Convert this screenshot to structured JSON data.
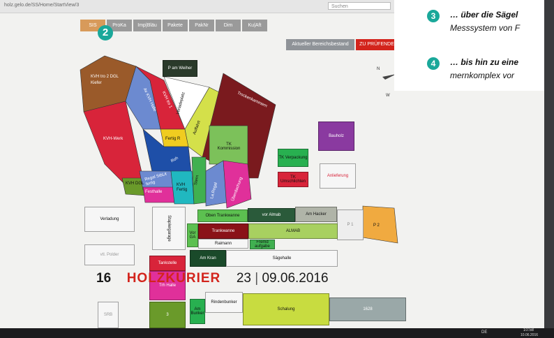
{
  "browser": {
    "url": "holz.gelo.de/SS/Home/StartView/3",
    "search_placeholder": "Suchen"
  },
  "menu": {
    "items": [
      "SIS",
      "ProKa",
      "Imp|Bläu",
      "Pakete",
      "PakNr",
      "Dim",
      "Ku|Aft"
    ],
    "active_index": 0
  },
  "badge_step": "2",
  "header_buttons": {
    "inventory": "Aktueller Bereichsbestand",
    "check": "ZU PRÜFENDE"
  },
  "zones": {
    "kvh_tro": "KVH tro 2 DGL Kiefer",
    "kvh_werk": "KVH-Werk",
    "av_kvh_halle": "Av KVH Halle",
    "kvh_tro1": "KVH tro 1",
    "p_am_weiher": "P am Weiher",
    "verladeplatz": "Verladeplatz",
    "fertig_rk": "Fertig R",
    "roh": "Roh",
    "auffahrt": "Auffahrt",
    "trockenkammern": "Trockenkammern",
    "tk_kommission": "TK Kommission",
    "bauholz": "Bauholz",
    "tk_verpackung": "TK Verpackung",
    "tk_umschlichten": "TK Umschlichten",
    "anlieferung": "Anlieferung",
    "regal_sibl": "Regal SibLit fertig",
    "kvh_dgl": "KVH DGL",
    "festhalle": "Festhalle",
    "kvh_fertig": "KVH Fertig",
    "stern": "Stern",
    "la_regal": "La.Regal",
    "ueberdachung": "Überdachung",
    "verladung": "Verladung",
    "stapler_garage": "Staplergarage",
    "oben_trankwanne": "Oben Trankwanne",
    "vor_almab": "vor Almab",
    "am_hacker": "Am Hacker",
    "p1": "P 1",
    "p2": "P 2",
    "vor_ga": "Vor GA",
    "trankwanne": "Trankwanne",
    "almab": "ALMAB",
    "raimann": "Raimann",
    "fremd_aufgabe": "Fremd aufgabe",
    "am_kran": "Am Kran",
    "saegehalle": "Sägehalle",
    "vtl_polder": "vtl. Polder",
    "tankstelle": "Tankstelle",
    "trh_halle": "Trh Halle",
    "srb": "SRB",
    "am_bunker": "Am Bunker",
    "rindenbunker": "Rindenbunker",
    "schalung": "Schalung",
    "zone_1628": "1628",
    "zone_3": "3"
  },
  "caption": {
    "page": "16",
    "brand": "HOLZKURIER",
    "issue": "23",
    "date": "09.06.2016"
  },
  "overlay": {
    "item3_num": "3",
    "item3_title": "… über die Sägel",
    "item3_sub": "Messsystem von F",
    "item4_num": "4",
    "item4_title": "… bis hin zu eine",
    "item4_sub": "mernkomplex vor",
    "compass_n": "N",
    "compass_w": "W"
  },
  "taskbar": {
    "lang": "DE",
    "time": "10:58",
    "date": "10.06.2016"
  },
  "colors": {
    "teal": "#1aa89a",
    "red": "#d3241c",
    "orange": "#d89a5a",
    "brown": "#9a5a2a"
  }
}
